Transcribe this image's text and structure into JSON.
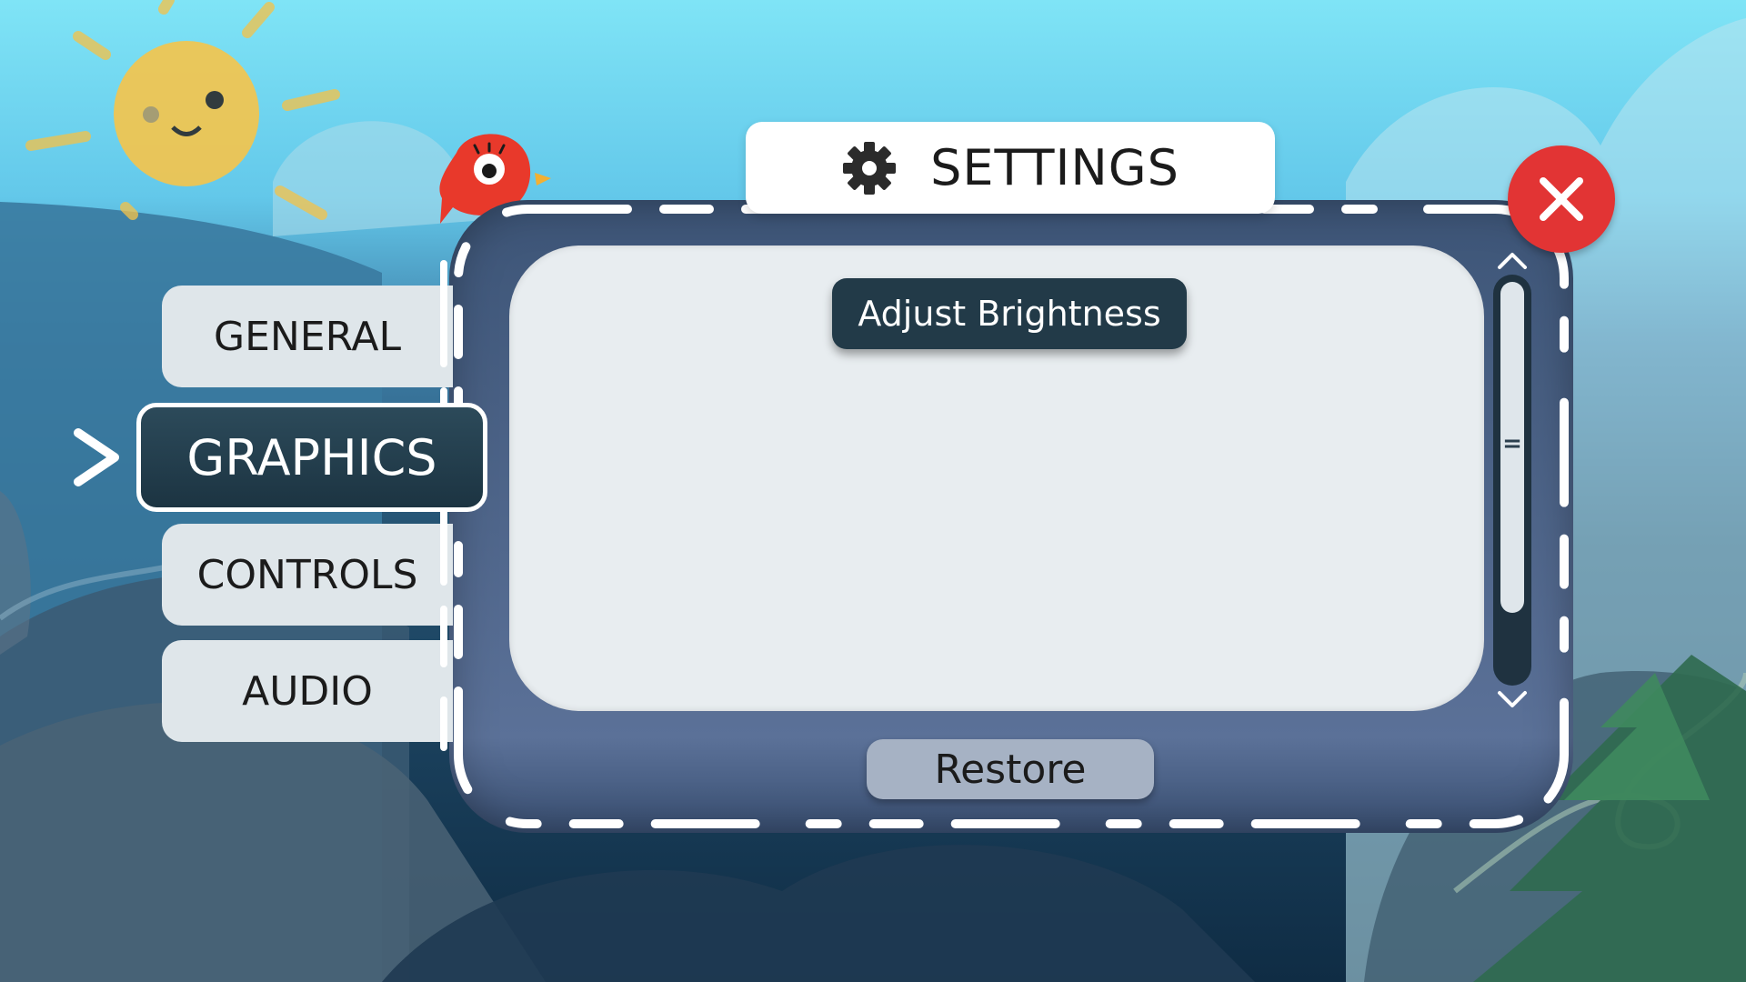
{
  "title": "SETTINGS",
  "tabs": [
    {
      "id": "general",
      "label": "GENERAL",
      "active": false
    },
    {
      "id": "graphics",
      "label": "GRAPHICS",
      "active": true
    },
    {
      "id": "controls",
      "label": "CONTROLS",
      "active": false
    },
    {
      "id": "audio",
      "label": "AUDIO",
      "active": false
    }
  ],
  "content": {
    "adjust_brightness_label": "Adjust Brightness"
  },
  "footer": {
    "restore_label": "Restore"
  },
  "scroll_grip_glyph": "=",
  "icons": {
    "title_icon": "gear-icon",
    "close_icon": "close-icon",
    "selection_icon": "chevron-right-icon",
    "scroll_up": "chevron-up-icon",
    "scroll_down": "chevron-down-icon",
    "mascot": "red-bird-icon",
    "sun": "sun-icon"
  },
  "colors": {
    "close_button": "#e23434",
    "active_tab": "#223a48",
    "panel": "#4b6289",
    "content_area": "#e8edf0",
    "restore_button": "#a6b2c4"
  }
}
